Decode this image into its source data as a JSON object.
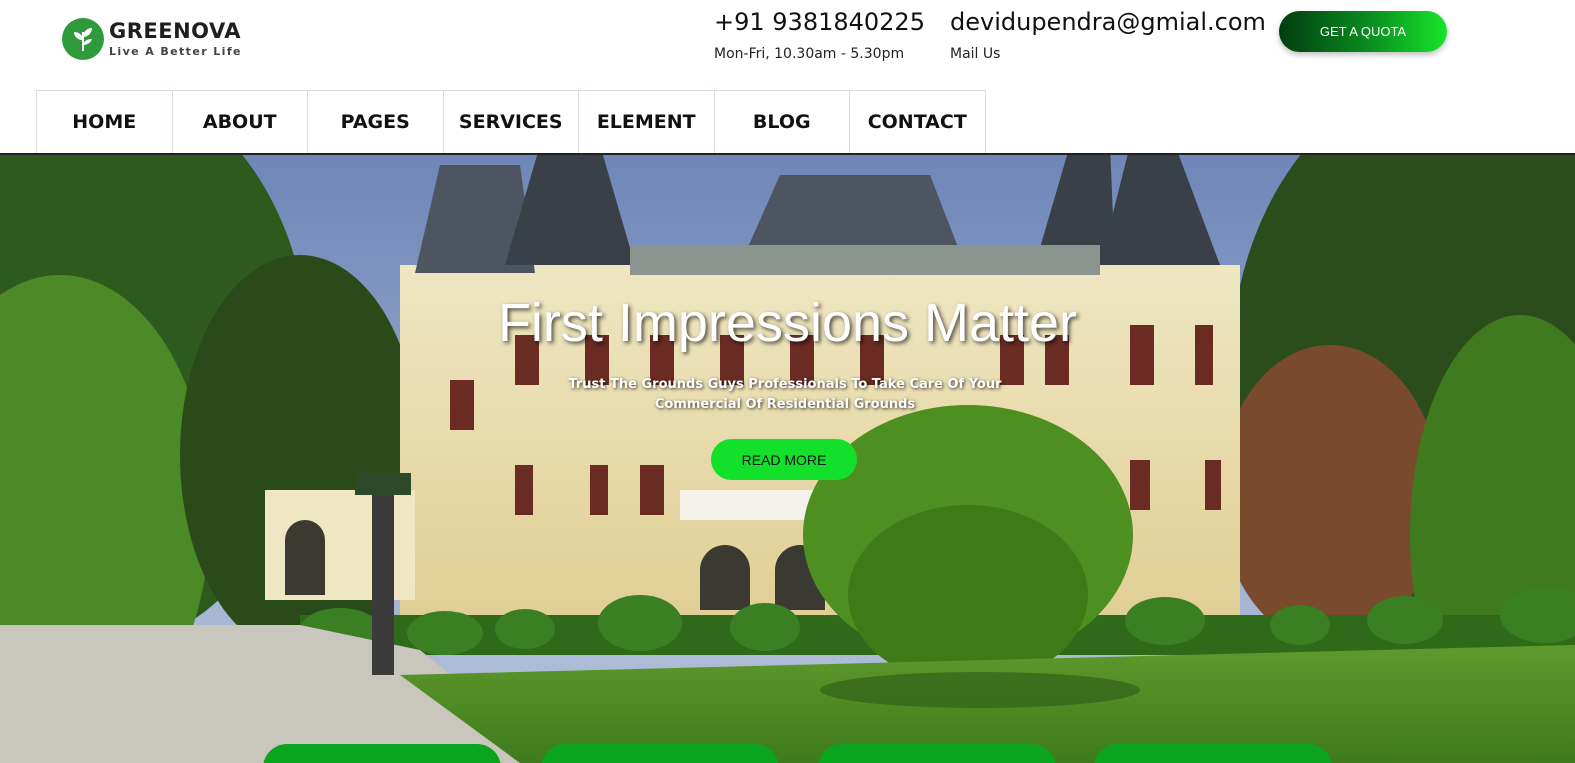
{
  "brand": {
    "name": "GREENOVA",
    "tagline": "Live A Better Life",
    "logo_icon": "leaf-icon",
    "accent_color": "#13e02a"
  },
  "contact": {
    "phone": "+91 9381840225",
    "hours": "Mon-Fri, 10.30am - 5.30pm",
    "email": "devidupendra@gmial.com",
    "mail_label": "Mail Us"
  },
  "header": {
    "quota_label": "GET A QUOTA"
  },
  "nav": {
    "items": [
      {
        "label": "HOME"
      },
      {
        "label": "ABOUT"
      },
      {
        "label": "PAGES"
      },
      {
        "label": "SERVICES"
      },
      {
        "label": "ELEMENT"
      },
      {
        "label": "BLOG"
      },
      {
        "label": "CONTACT"
      }
    ]
  },
  "hero": {
    "title": "First Impressions Matter",
    "subtitle": "Trust The Grounds Guys Professionals To Take Care Of Your Commercial Of Residential Grounds",
    "button_label": "READ MORE"
  }
}
